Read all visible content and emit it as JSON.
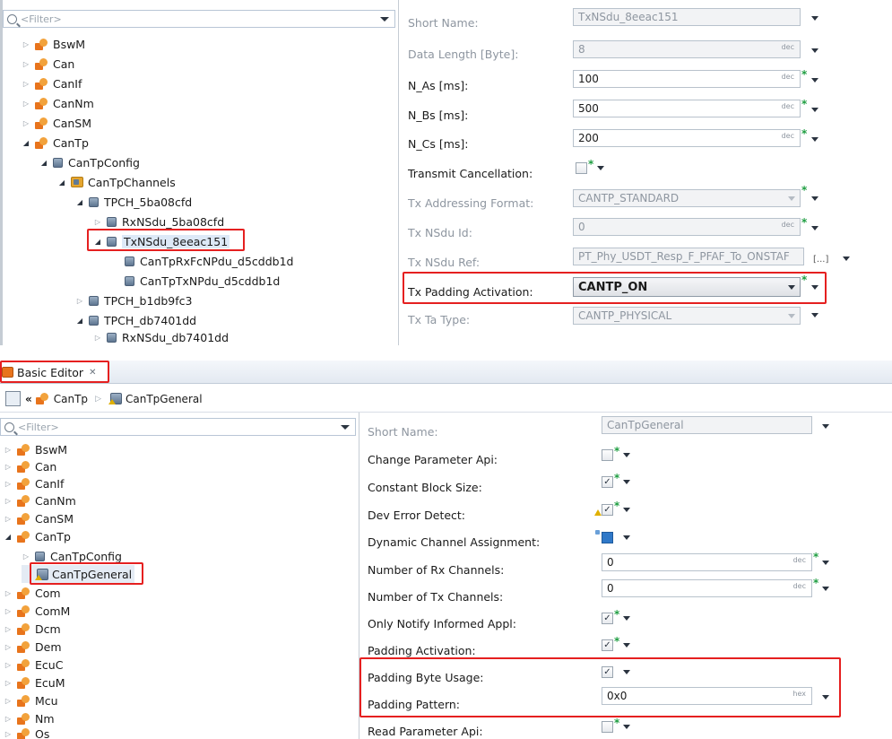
{
  "top": {
    "filter_placeholder": "<Filter>",
    "tree": [
      {
        "label": "BswM",
        "kind": "module",
        "twisty": "closed"
      },
      {
        "label": "Can",
        "kind": "module",
        "twisty": "closed"
      },
      {
        "label": "CanIf",
        "kind": "module",
        "twisty": "closed"
      },
      {
        "label": "CanNm",
        "kind": "module",
        "twisty": "closed"
      },
      {
        "label": "CanSM",
        "kind": "module",
        "twisty": "closed"
      },
      {
        "label": "CanTp",
        "kind": "module",
        "twisty": "open"
      },
      {
        "label": "CanTpConfig",
        "kind": "container",
        "twisty": "open"
      },
      {
        "label": "CanTpChannels",
        "kind": "folder",
        "twisty": "open"
      },
      {
        "label": "TPCH_5ba08cfd",
        "kind": "container",
        "twisty": "open"
      },
      {
        "label": "RxNSdu_5ba08cfd",
        "kind": "container",
        "twisty": "closed"
      },
      {
        "label": "TxNSdu_8eeac151",
        "kind": "container",
        "twisty": "open"
      },
      {
        "label": "CanTpRxFcNPdu_d5cddb1d",
        "kind": "container",
        "twisty": "none"
      },
      {
        "label": "CanTpTxNPdu_d5cddb1d",
        "kind": "container",
        "twisty": "none"
      },
      {
        "label": "TPCH_b1db9fc3",
        "kind": "container",
        "twisty": "closed"
      },
      {
        "label": "TPCH_db7401dd",
        "kind": "container",
        "twisty": "open"
      },
      {
        "label": "RxNSdu_db7401dd",
        "kind": "container",
        "twisty": "closed"
      }
    ],
    "params": [
      {
        "label": "Short Name:",
        "value": "TxNSdu_8eeac151",
        "disabled": true,
        "type": "text"
      },
      {
        "label": "Data Length [Byte]:",
        "value": "8",
        "unit": "dec",
        "disabled": true,
        "type": "text"
      },
      {
        "label": "N_As [ms]:",
        "value": "100",
        "unit": "dec",
        "disabled": false,
        "type": "text"
      },
      {
        "label": "N_Bs [ms]:",
        "value": "500",
        "unit": "dec",
        "disabled": false,
        "type": "text"
      },
      {
        "label": "N_Cs [ms]:",
        "value": "200",
        "unit": "dec",
        "disabled": false,
        "type": "text"
      },
      {
        "label": "Transmit Cancellation:",
        "value": "",
        "disabled": false,
        "type": "check"
      },
      {
        "label": "Tx Addressing Format:",
        "value": "CANTP_STANDARD",
        "disabled": true,
        "type": "combo"
      },
      {
        "label": "Tx NSdu Id:",
        "value": "0",
        "unit": "dec",
        "disabled": true,
        "type": "text"
      },
      {
        "label": "Tx NSdu Ref:",
        "value": "PT_Phy_USDT_Resp_F_PFAF_To_ONSTAF",
        "ref_button": "[...]",
        "disabled": true,
        "type": "ref"
      },
      {
        "label": "Tx Padding Activation:",
        "value": "CANTP_ON",
        "disabled": false,
        "type": "combo"
      },
      {
        "label": "Tx Ta Type:",
        "value": "CANTP_PHYSICAL",
        "disabled": true,
        "type": "combo"
      }
    ]
  },
  "editor": {
    "tab_label": "Basic Editor",
    "tab_close": "✕",
    "breadcrumb_sep": "«",
    "breadcrumb": [
      "CanTp",
      "CanTpGeneral"
    ]
  },
  "bottom": {
    "filter_placeholder": "<Filter>",
    "tree": [
      {
        "label": "BswM",
        "kind": "module",
        "twisty": "closed"
      },
      {
        "label": "Can",
        "kind": "module",
        "twisty": "closed"
      },
      {
        "label": "CanIf",
        "kind": "module",
        "twisty": "closed"
      },
      {
        "label": "CanNm",
        "kind": "module",
        "twisty": "closed"
      },
      {
        "label": "CanSM",
        "kind": "module",
        "twisty": "closed"
      },
      {
        "label": "CanTp",
        "kind": "module",
        "twisty": "open"
      },
      {
        "label": "CanTpConfig",
        "kind": "container",
        "twisty": "closed"
      },
      {
        "label": "CanTpGeneral",
        "kind": "general",
        "twisty": "none"
      },
      {
        "label": "Com",
        "kind": "module",
        "twisty": "closed"
      },
      {
        "label": "ComM",
        "kind": "module",
        "twisty": "closed"
      },
      {
        "label": "Dcm",
        "kind": "module",
        "twisty": "closed"
      },
      {
        "label": "Dem",
        "kind": "module",
        "twisty": "closed"
      },
      {
        "label": "EcuC",
        "kind": "module",
        "twisty": "closed"
      },
      {
        "label": "EcuM",
        "kind": "module",
        "twisty": "closed"
      },
      {
        "label": "Mcu",
        "kind": "module",
        "twisty": "closed"
      },
      {
        "label": "Nm",
        "kind": "module",
        "twisty": "closed"
      },
      {
        "label": "Os",
        "kind": "module",
        "twisty": "closed"
      }
    ],
    "params": [
      {
        "label": "Short Name:",
        "value": "CanTpGeneral",
        "disabled": true,
        "type": "text"
      },
      {
        "label": "Change Parameter Api:",
        "value": "",
        "disabled": false,
        "type": "check"
      },
      {
        "label": "Constant Block Size:",
        "value": "✓",
        "disabled": false,
        "type": "check"
      },
      {
        "label": "Dev Error Detect:",
        "value": "✓",
        "disabled": false,
        "type": "check"
      },
      {
        "label": "Dynamic Channel Assignment:",
        "value": "",
        "disabled": false,
        "type": "check"
      },
      {
        "label": "Number of Rx Channels:",
        "value": "0",
        "unit": "dec",
        "disabled": false,
        "type": "text"
      },
      {
        "label": "Number of Tx Channels:",
        "value": "0",
        "unit": "dec",
        "disabled": false,
        "type": "text"
      },
      {
        "label": "Only Notify Informed Appl:",
        "value": "✓",
        "disabled": false,
        "type": "check"
      },
      {
        "label": "Padding Activation:",
        "value": "✓",
        "disabled": false,
        "type": "check"
      },
      {
        "label": "Padding Byte Usage:",
        "value": "✓",
        "disabled": false,
        "type": "check"
      },
      {
        "label": "Padding Pattern:",
        "value": "0x0",
        "unit": "hex",
        "disabled": false,
        "type": "text"
      },
      {
        "label": "Read Parameter Api:",
        "value": "",
        "disabled": false,
        "type": "check"
      }
    ]
  },
  "colors": {
    "highlight": "#e52020",
    "changed_star": "#1f9e42"
  }
}
